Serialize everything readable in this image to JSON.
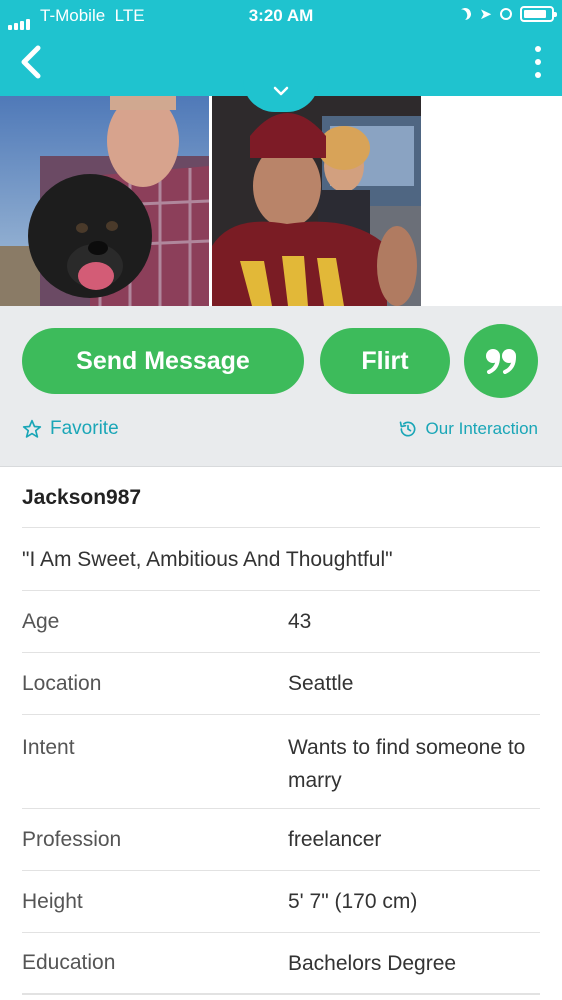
{
  "status_bar": {
    "carrier": "T-Mobile",
    "network": "LTE",
    "time": "3:20 AM",
    "battery_level": 0.85
  },
  "nav": {
    "back_icon": "chevron-left-icon",
    "menu_icon": "kebab-menu-icon",
    "expand_icon": "chevron-down-icon"
  },
  "actions": {
    "send_message_label": "Send Message",
    "flirt_label": "Flirt",
    "quote_icon": "quote-icon",
    "favorite_label": "Favorite",
    "interaction_label": "Our Interaction"
  },
  "profile": {
    "username": "Jackson987",
    "tagline": "\"I Am Sweet, Ambitious And Thoughtful\"",
    "fields": [
      {
        "label": "Age",
        "value": "43"
      },
      {
        "label": "Location",
        "value": "Seattle"
      },
      {
        "label": "Intent",
        "value": "Wants to find someone to marry"
      },
      {
        "label": "Profession",
        "value": "freelancer"
      },
      {
        "label": "Height",
        "value": "5' 7\" (170 cm)"
      },
      {
        "label": "Education",
        "value": "Bachelors Degree"
      }
    ]
  },
  "colors": {
    "header": "#1fc3cf",
    "button_green": "#3dbb5b",
    "link_teal": "#1aa6b7",
    "action_bg": "#e9ebed"
  }
}
